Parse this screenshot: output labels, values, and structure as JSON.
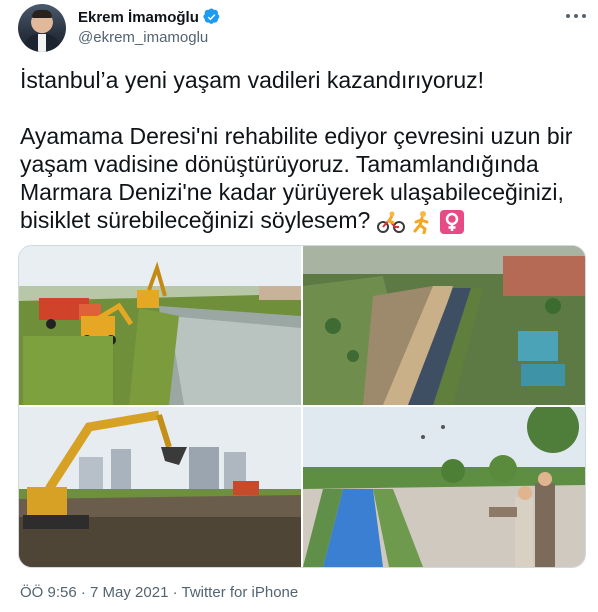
{
  "tweet": {
    "author_name": "Ekrem İmamoğlu",
    "author_handle": "@ekrem_imamoglu",
    "verified": true,
    "lines": [
      "İstanbul’a yeni yaşam vadileri kazandırıyoruz!",
      "",
      "Ayamama Deresi'ni rehabilite ediyor çevresini uzun bir",
      "yaşam vadisine dönüştürüyoruz. Tamamlandığında",
      "Marmara Denizi'ne kadar yürüyerek ulaşabileceğinizi,",
      "bisiklet sürebileceğinizi söylesem?"
    ],
    "emojis": [
      "cyclist-emoji",
      "runner-emoji",
      "female-sign-emoji"
    ],
    "time": "ÖÖ 9:56",
    "separator": "·",
    "date": "7 May 2021",
    "source": "Twitter for iPhone"
  },
  "icons": {
    "verified": "verified-badge-icon",
    "more": "more-options-icon"
  },
  "media": [
    {
      "name": "excavator-riverbank-photo"
    },
    {
      "name": "aerial-river-photo"
    },
    {
      "name": "excavator-city-photo"
    },
    {
      "name": "park-rendering-photo"
    }
  ],
  "colors": {
    "text": "#0f1419",
    "secondary": "#536471",
    "verified": "#1d9bf0",
    "border": "#cfd9de"
  }
}
